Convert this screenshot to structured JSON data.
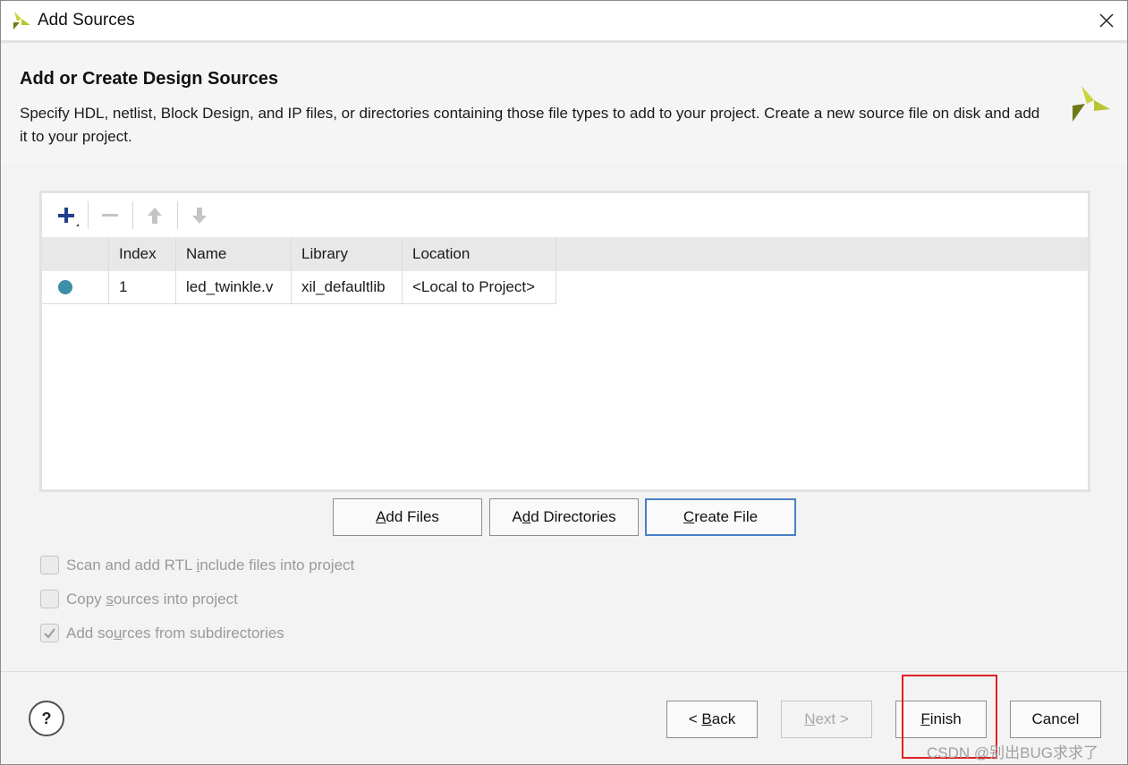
{
  "window": {
    "title": "Add Sources",
    "close_icon": "close-icon"
  },
  "header": {
    "heading": "Add or Create Design Sources",
    "description": "Specify HDL, netlist, Block Design, and IP files, or directories containing those file types to add to your project. Create a new source file on disk and add it to your project."
  },
  "toolbar": {
    "icons": [
      "plus-icon",
      "minus-icon",
      "arrow-up-icon",
      "arrow-down-icon"
    ]
  },
  "table": {
    "columns": [
      "",
      "Index",
      "Name",
      "Library",
      "Location"
    ],
    "rows": [
      {
        "status_color": "#3d8ea8",
        "index": "1",
        "name": "led_twinkle.v",
        "library": "xil_defaultlib",
        "location": "<Local to Project>"
      }
    ]
  },
  "actions": {
    "add_files": {
      "pre": "",
      "mnemonic": "A",
      "post": "dd Files"
    },
    "add_directories": {
      "pre": "A",
      "mnemonic": "d",
      "post": "d Directories"
    },
    "create_file": {
      "pre": "",
      "mnemonic": "C",
      "post": "reate File"
    }
  },
  "options": [
    {
      "pre": "Scan and add RTL ",
      "mnemonic": "i",
      "post": "nclude files into project",
      "checked": false
    },
    {
      "pre": "Copy ",
      "mnemonic": "s",
      "post": "ources into project",
      "checked": false
    },
    {
      "pre": "Add so",
      "mnemonic": "u",
      "post": "rces from subdirectories",
      "checked": true
    }
  ],
  "footer": {
    "help": "?",
    "back": {
      "pre": "< ",
      "mnemonic": "B",
      "post": "ack"
    },
    "next": {
      "pre": "",
      "mnemonic": "N",
      "post": "ext >"
    },
    "finish": {
      "pre": "",
      "mnemonic": "F",
      "post": "inish"
    },
    "cancel": "Cancel"
  },
  "watermark": "CSDN @别出BUG求求了"
}
